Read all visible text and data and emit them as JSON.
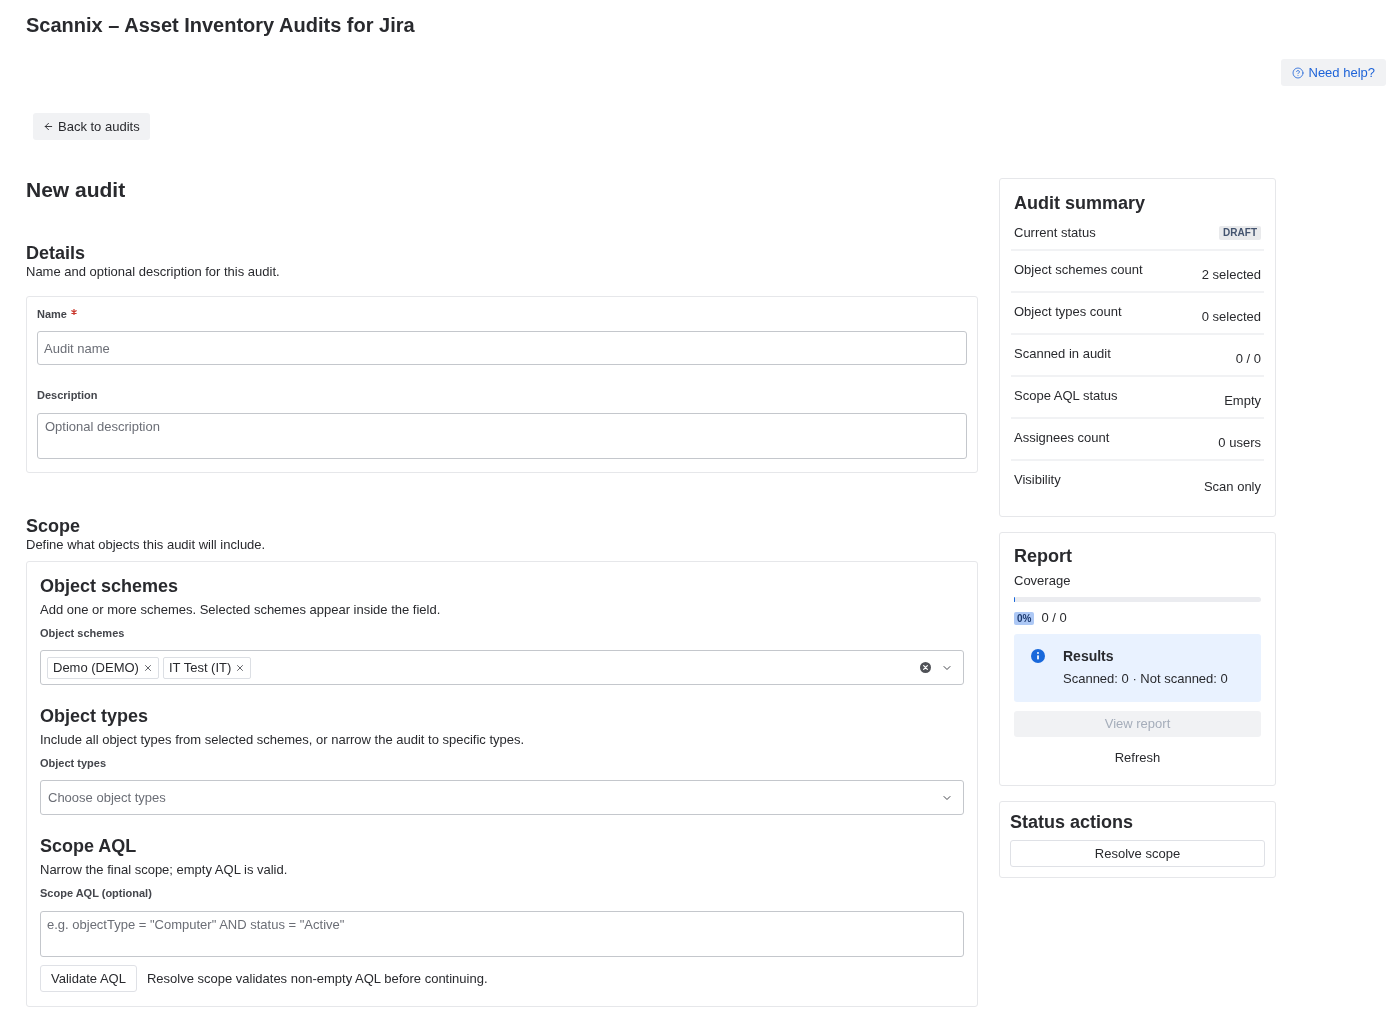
{
  "app_title": "Scannix – Asset Inventory Audits for Jira",
  "help_button": {
    "label": "Need help?"
  },
  "back_button": {
    "label": "Back to audits"
  },
  "page_title": "New audit",
  "details": {
    "title": "Details",
    "subtitle": "Name and optional description for this audit.",
    "fields": [
      {
        "kind": "input",
        "label": "Name",
        "required": true,
        "placeholder": "Audit name"
      },
      {
        "kind": "textarea",
        "label": "Description",
        "required": false,
        "placeholder": "Optional description"
      }
    ]
  },
  "scope": {
    "title": "Scope",
    "subtitle": "Define what objects this audit will include.",
    "sections": [
      {
        "kind": "multi_select",
        "title": "Object schemes",
        "description": "Add one or more schemes. Selected schemes appear inside the field.",
        "label": "Object schemes",
        "tags": [
          "Demo (DEMO)",
          "IT Test (IT)"
        ]
      },
      {
        "kind": "select",
        "title": "Object types",
        "description": "Include all object types from selected schemes, or narrow the audit to specific types.",
        "label": "Object types",
        "placeholder": "Choose object types"
      },
      {
        "kind": "aql",
        "title": "Scope AQL",
        "description": "Narrow the final scope; empty AQL is valid.",
        "label": "Scope AQL (optional)",
        "placeholder": "e.g. objectType = \"Computer\" AND status = \"Active\"",
        "button": "Validate AQL",
        "note": "Resolve scope validates non-empty AQL before continuing."
      }
    ]
  },
  "summary": {
    "title": "Audit summary",
    "rows": [
      {
        "kind": "badge",
        "label": "Current status",
        "value": "DRAFT"
      },
      {
        "kind": "text",
        "label": "Object schemes count",
        "value": "2 selected"
      },
      {
        "kind": "text",
        "label": "Object types count",
        "value": "0 selected"
      },
      {
        "kind": "text",
        "label": "Scanned in audit",
        "value": "0 / 0"
      },
      {
        "kind": "text",
        "label": "Scope AQL status",
        "value": "Empty"
      },
      {
        "kind": "text",
        "label": "Assignees count",
        "value": "0 users"
      },
      {
        "kind": "text",
        "label": "Visibility",
        "value": "Scan only"
      }
    ]
  },
  "report": {
    "title": "Report",
    "coverage_label": "Coverage",
    "level": 0,
    "percent": "0%",
    "count": "0 / 0",
    "results": {
      "title": "Results",
      "text": "Scanned: 0 · Not scanned: 0"
    },
    "view_button": {
      "label": "View report",
      "disabled": true
    },
    "refresh_button": {
      "label": "Refresh"
    }
  },
  "status_actions": {
    "title": "Status actions",
    "buttons": [
      {
        "label": "Resolve scope"
      }
    ]
  }
}
